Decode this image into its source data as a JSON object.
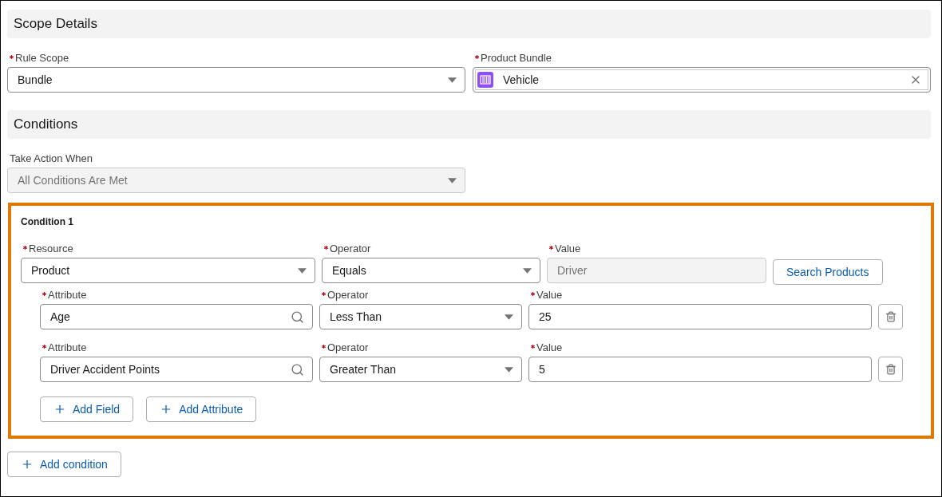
{
  "scope_details": {
    "title": "Scope Details",
    "fields": [
      {
        "kind": "select",
        "label": "Rule Scope",
        "required": true,
        "disabled": false,
        "value": "Bundle"
      },
      {
        "kind": "lookup",
        "label": "Product Bundle",
        "required": true,
        "disabled": false,
        "value": "Vehicle"
      }
    ]
  },
  "conditions": {
    "title": "Conditions",
    "take_action_when": {
      "kind": "select",
      "label": "Take Action When",
      "disabled": true,
      "value": "All Conditions Are Met"
    },
    "items": [
      {
        "title": "Condition 1",
        "highlighted": true,
        "fields": [
          {
            "kind": "select",
            "label": "Resource",
            "required": true,
            "disabled": false,
            "value": "Product"
          },
          {
            "kind": "select",
            "label": "Operator",
            "required": true,
            "disabled": false,
            "value": "Equals"
          },
          {
            "kind": "text",
            "label": "Value",
            "required": true,
            "disabled": true,
            "value": "Driver"
          }
        ],
        "search_button": "Search Products",
        "attributes": [
          {
            "fields": [
              {
                "kind": "search",
                "label": "Attribute",
                "required": true,
                "disabled": false,
                "value": "Age"
              },
              {
                "kind": "select",
                "label": "Operator",
                "required": true,
                "disabled": false,
                "value": "Less Than"
              },
              {
                "kind": "text",
                "label": "Value",
                "required": true,
                "disabled": false,
                "value": "25"
              }
            ]
          },
          {
            "fields": [
              {
                "kind": "search",
                "label": "Attribute",
                "required": true,
                "disabled": false,
                "value": "Driver Accident Points"
              },
              {
                "kind": "select",
                "label": "Operator",
                "required": true,
                "disabled": false,
                "value": "Greater Than"
              },
              {
                "kind": "text",
                "label": "Value",
                "required": true,
                "disabled": false,
                "value": "5"
              }
            ]
          }
        ],
        "buttons": [
          "Add Field",
          "Add Attribute"
        ]
      }
    ],
    "add_condition_button": "Add condition"
  }
}
